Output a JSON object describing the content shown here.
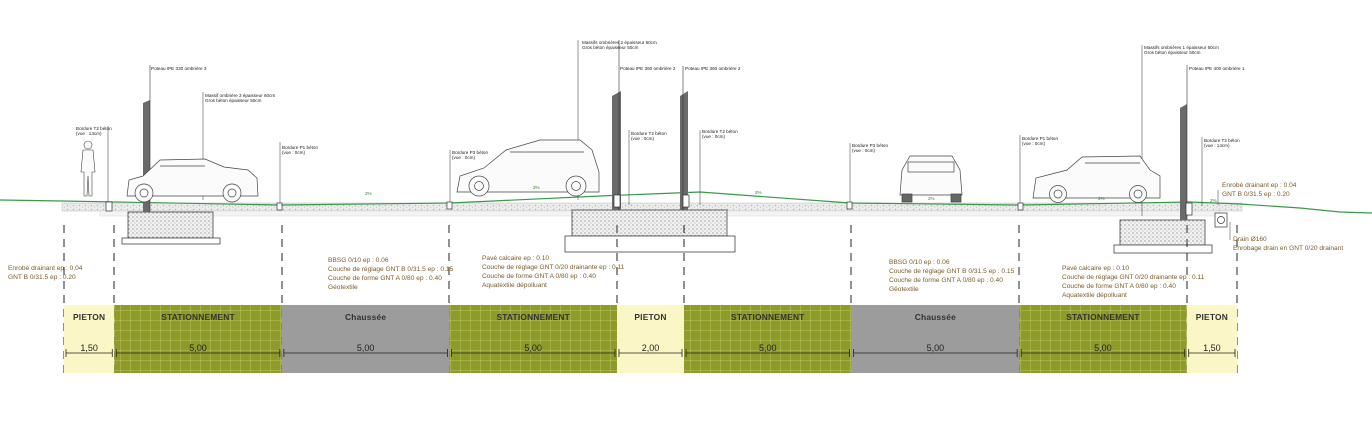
{
  "bands": [
    {
      "name": "PIETON",
      "width": "1,50",
      "type": "pieton",
      "units": 1.5
    },
    {
      "name": "STATIONNEMENT",
      "width": "5,00",
      "type": "parking",
      "units": 5
    },
    {
      "name": "Chaussée",
      "width": "5,00",
      "type": "road",
      "units": 5
    },
    {
      "name": "STATIONNEMENT",
      "width": "5,00",
      "type": "parking",
      "units": 5
    },
    {
      "name": "PIETON",
      "width": "2,00",
      "type": "pieton",
      "units": 2
    },
    {
      "name": "STATIONNEMENT",
      "width": "5,00",
      "type": "parking",
      "units": 5
    },
    {
      "name": "Chaussée",
      "width": "5,00",
      "type": "road",
      "units": 5
    },
    {
      "name": "STATIONNEMENT",
      "width": "5,00",
      "type": "parking",
      "units": 5
    },
    {
      "name": "PIETON",
      "width": "1,50",
      "type": "pieton",
      "units": 1.5
    }
  ],
  "colors": {
    "pieton": "#fbf6c6",
    "parking": "#8e9a2a",
    "road": "#9c9c9c",
    "ground": "#3a9a4a",
    "grid": "#c7d36a",
    "post": "#6a6a6a",
    "spec_text": "#7a5a2a"
  },
  "specs": {
    "left_edge": [
      "Enrobé drainant ep : 0.04",
      "GNT B 0/31.5 ep : 0.20"
    ],
    "bbsg_1": [
      "BBSG 0/10 ep : 0.06",
      "Couche de réglage GNT B 0/31.5 ep : 0.15",
      "Couche de forme GNT A 0/80 ep : 0.40",
      "Géotextile"
    ],
    "pave_1": [
      "Pavé calcaire ep : 0.10",
      "Couche de réglage GNT 0/20 drainante ep : 0.11",
      "Couche de forme GNT A 0/80 ep : 0.40",
      "Aquatextile dépolluant"
    ],
    "bbsg_2": [
      "BBSG 0/10 ep : 0.06",
      "Couche de réglage GNT B 0/31.5 ep : 0.15",
      "Couche de forme GNT A 0/80 ep : 0.40",
      "Géotextile"
    ],
    "pave_2": [
      "Pavé calcaire ep : 0.10",
      "Couche de réglage GNT 0/20 drainante ep : 0.11",
      "Couche de forme GNT A 0/80 ep : 0.40",
      "Aquatextile dépolluant"
    ],
    "right_top": [
      "Enrobé drainant ep : 0.04",
      "GNT B 0/31.5 ep : 0.20"
    ],
    "drain": [
      "Drain Ø160",
      "Enrobage drain en GNT 0/20 drainant"
    ]
  },
  "callouts": {
    "post_1": [
      "Poteau IPE 330 ombrière 3"
    ],
    "massif_1": [
      "Massif ombrière 3 épaisseur 60cm",
      "Gros béton épaisseur 50cm"
    ],
    "massif_2": [
      "Massifs ombrières 2 épaisseur 60cm",
      "Gros béton épaisseur 50cm"
    ],
    "post_2a": [
      "Poteau IPE 360 ombrière 2"
    ],
    "post_2b": [
      "Poteau IPE 360 ombrière 2"
    ],
    "massif_3": [
      "Massifs ombrières 1 épaisseur 60cm",
      "Gros béton épaisseur 50cm"
    ],
    "post_3": [
      "Poteau IPE 400 ombrière 1"
    ],
    "bord_t2_left": [
      "Bordure T2 béton",
      "(vue : 14cm)"
    ],
    "bord_p1_a": [
      "Bordure P1 béton",
      "(vue : 0cm)"
    ],
    "bord_p3_a": [
      "Bordure P3 béton",
      "(vue : 0cm)"
    ],
    "bord_t2_a": [
      "Bordure T2 béton",
      "(vue : 0cm)"
    ],
    "bord_t2_b": [
      "Bordure T2 béton",
      "(vue : 0cm)"
    ],
    "bord_p3_b": [
      "Bordure P3 béton",
      "(vue : 0cm)"
    ],
    "bord_p1_b": [
      "Bordure P1 béton",
      "(vue : 0cm)"
    ],
    "bord_t2_right": [
      "Bordure T2 béton",
      "(vue : 14cm)"
    ]
  },
  "slopes": [
    "2%",
    "2%",
    "2%",
    "2%",
    "2%",
    "2%"
  ]
}
